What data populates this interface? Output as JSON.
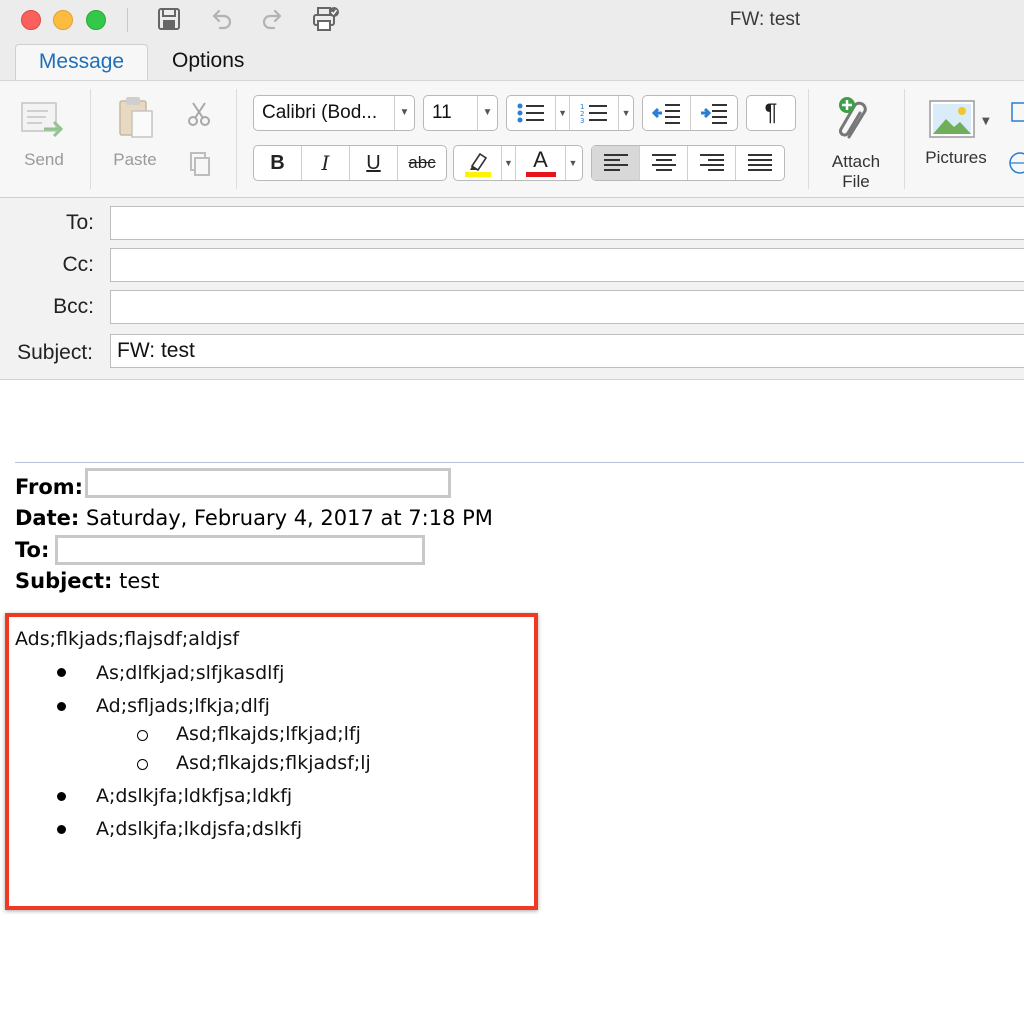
{
  "window": {
    "title": "FW: test"
  },
  "tabs": [
    {
      "label": "Message",
      "active": true
    },
    {
      "label": "Options",
      "active": false
    }
  ],
  "ribbon": {
    "send_label": "Send",
    "paste_label": "Paste",
    "font_name": "Calibri (Bod...",
    "font_size": "11",
    "attach_label_line1": "Attach",
    "attach_label_line2": "File",
    "pictures_label": "Pictures",
    "format_bold": "B",
    "format_italic": "I",
    "format_underline": "U",
    "format_strike": "abc",
    "font_color_glyph": "A",
    "paragraph_glyph": "¶",
    "highlight_color": "#fff200",
    "font_color": "#e8141b"
  },
  "fields": {
    "to_label": "To:",
    "cc_label": "Cc:",
    "bcc_label": "Bcc:",
    "subject_label": "Subject:",
    "subject_value": "FW: test"
  },
  "forwarded": {
    "from_label": "From:",
    "date_label": "Date:",
    "date_value": "Saturday, February 4, 2017 at 7:18 PM",
    "to_label": "To:",
    "subject_label": "Subject:",
    "subject_value": "test"
  },
  "body": {
    "first_line": "Ads;flkjads;flajsdf;aldjsf",
    "list": [
      {
        "text": "As;dlfkjad;slfjkasdlfj",
        "level": 1
      },
      {
        "text": "Ad;sfljads;lfkja;dlfj",
        "level": 1
      },
      {
        "text": "Asd;flkajds;lfkjad;lfj",
        "level": 2
      },
      {
        "text": "Asd;flkajds;flkjadsf;lj",
        "level": 2
      },
      {
        "text": "A;dslkjfa;ldkfjsa;ldkfj",
        "level": 1
      },
      {
        "text": "A;dslkjfa;lkdjsfa;dslkfj",
        "level": 1
      }
    ]
  },
  "colors": {
    "annotation_box": "#ee3a22",
    "tab_active_text": "#1f6fb8"
  }
}
